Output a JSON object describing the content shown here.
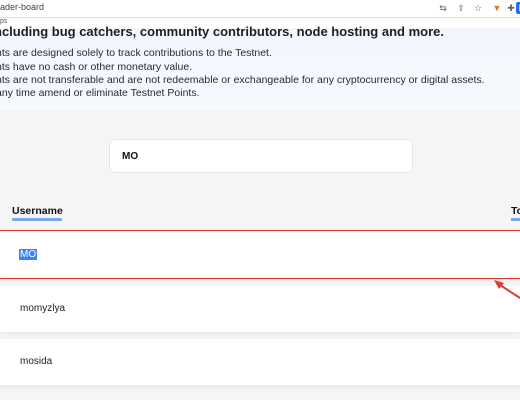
{
  "browser": {
    "url_fragment": "ader-board",
    "bookmark_fragment": "ps",
    "extensions": [
      "translate-icon",
      "share-icon",
      "star-icon",
      "puzzle-icon",
      "fox-icon",
      "extensions-icon",
      "k-extension-icon"
    ],
    "k_label": "K"
  },
  "hero": {
    "title": "ncluding bug catchers, community contributors, node hosting and more.",
    "lines": [
      "nts are designed solely to track contributions to the Testnet.",
      "nts have no cash or other monetary value.",
      "nts are not transferable and are not redeemable or exchangeable for any cryptocurrency or digital assets.",
      "any time amend or eliminate Testnet Points."
    ]
  },
  "search": {
    "value": "MO"
  },
  "table": {
    "columns": {
      "username": "Username",
      "total": "To"
    },
    "rows": [
      {
        "username": "MO",
        "selected": true
      },
      {
        "username": "momyzlya"
      },
      {
        "username": "mosida"
      }
    ]
  },
  "colors": {
    "accent": "#7aa6e8",
    "highlight": "#e23a2f",
    "selection": "#3b82f6"
  }
}
